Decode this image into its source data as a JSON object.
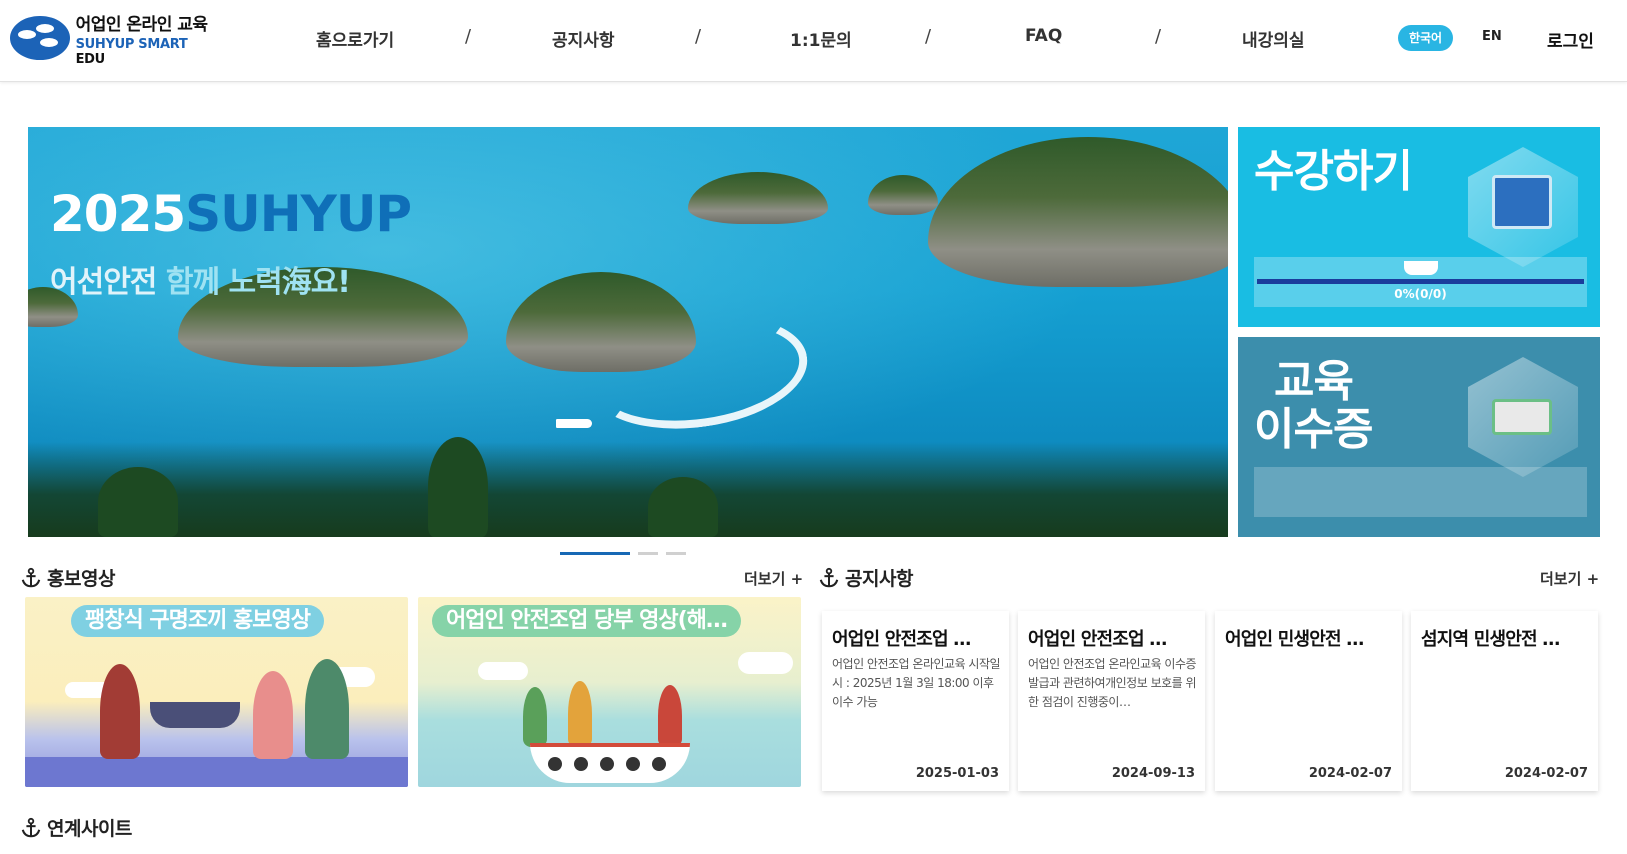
{
  "header": {
    "logo_ko": "어업인 온라인 교육",
    "logo_en_part1": "SUHYUP SMART",
    "logo_en_part2": "EDU",
    "nav": [
      {
        "label": "홈으로가기"
      },
      {
        "label": "공지사항"
      },
      {
        "label": "1:1문의"
      },
      {
        "label": "FAQ"
      },
      {
        "label": "내강의실"
      }
    ],
    "nav_separator": "/",
    "lang_ko": "한국어",
    "lang_en": "EN",
    "login": "로그인"
  },
  "hero": {
    "year": "2025",
    "brand": "SUHYUP",
    "sub_part1": "어선안전",
    "sub_part2": "함께 노력海요!"
  },
  "tiles": {
    "course_label": "수강하기",
    "progress_text": "0%(0/0)",
    "progress_fraction": 0,
    "cert_line1": "교육",
    "cert_line2": "이수증"
  },
  "slider": {
    "count": 3,
    "active": 0
  },
  "promo": {
    "heading": "홍보영상",
    "more": "더보기 +",
    "videos": [
      {
        "title": "팽창식 구명조끼 홍보영상"
      },
      {
        "title": "어업인 안전조업 당부 영상(해…"
      }
    ]
  },
  "notice": {
    "heading": "공지사항",
    "more": "더보기 +",
    "items": [
      {
        "title": "어업인 안전조업 …",
        "body": "어업인 안전조업 온라인교육 시작일시 : 2025년 1월 3일 18:00 이후 이수 가능",
        "date": "2025-01-03"
      },
      {
        "title": "어업인 안전조업 …",
        "body": "어업인 안전조업 온라인교육 이수증 발급과 관련하여개인정보 보호를 위한 점검이 진행중이…",
        "date": "2024-09-13"
      },
      {
        "title": "어업인 민생안전 …",
        "body": "",
        "date": "2024-02-07"
      },
      {
        "title": "섬지역 민생안전 …",
        "body": "",
        "date": "2024-02-07"
      }
    ]
  },
  "links": {
    "heading": "연계사이트"
  },
  "colors": {
    "accent": "#1768b5",
    "course_tile": "#19bde3",
    "cert_tile": "#3c8eac",
    "lang_badge": "#29b5e3"
  }
}
